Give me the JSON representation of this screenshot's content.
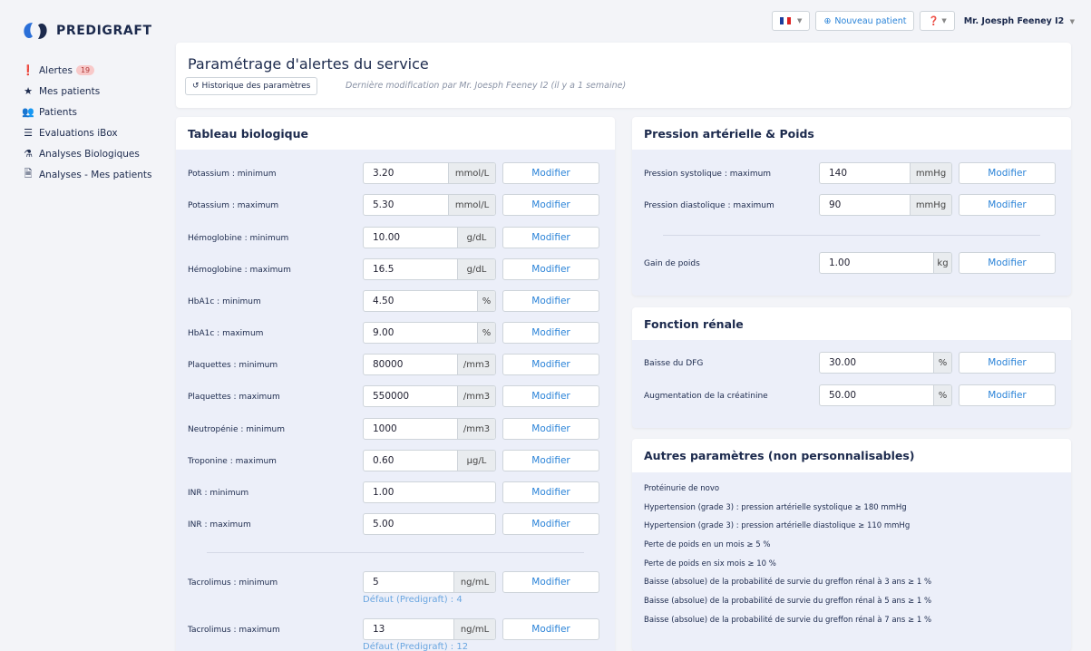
{
  "brand": {
    "name": "PREDIGRAFT"
  },
  "sidebar": {
    "items": [
      {
        "icon": "alert-icon",
        "label": "Alertes",
        "badge": "19"
      },
      {
        "icon": "star-icon",
        "label": "Mes patients"
      },
      {
        "icon": "users-icon",
        "label": "Patients"
      },
      {
        "icon": "sliders-icon",
        "label": "Evaluations iBox"
      },
      {
        "icon": "test-tube-icon",
        "label": "Analyses Biologiques"
      },
      {
        "icon": "document-star-icon",
        "label": "Analyses - Mes patients"
      }
    ]
  },
  "topbar": {
    "new_patient": "Nouveau patient",
    "user": "Mr. Joesph Feeney I2"
  },
  "header": {
    "title": "Paramétrage d'alertes du service",
    "history_button": "Historique des paramètres",
    "last_modified": "Dernière modification par Mr. Joesph Feeney I2 (il y a 1 semaine)"
  },
  "modify_label": "Modifier",
  "bio": {
    "title": "Tableau biologique",
    "rows": [
      {
        "label": "Potassium : minimum",
        "value": "3.20",
        "unit": "mmol/L"
      },
      {
        "label": "Potassium : maximum",
        "value": "5.30",
        "unit": "mmol/L"
      },
      {
        "label": "Hémoglobine : minimum",
        "value": "10.00",
        "unit": "g/dL"
      },
      {
        "label": "Hémoglobine : maximum",
        "value": "16.5",
        "unit": "g/dL"
      },
      {
        "label": "HbA1c : minimum",
        "value": "4.50",
        "unit": "%"
      },
      {
        "label": "HbA1c : maximum",
        "value": "9.00",
        "unit": "%"
      },
      {
        "label": "Plaquettes : minimum",
        "value": "80000",
        "unit": "/mm3"
      },
      {
        "label": "Plaquettes : maximum",
        "value": "550000",
        "unit": "/mm3"
      },
      {
        "label": "Neutropénie : minimum",
        "value": "1000",
        "unit": "/mm3"
      },
      {
        "label": "Troponine : maximum",
        "value": "0.60",
        "unit": "µg/L"
      },
      {
        "label": "INR : minimum",
        "value": "1.00",
        "unit": ""
      },
      {
        "label": "INR : maximum",
        "value": "5.00",
        "unit": ""
      }
    ],
    "tacro": [
      {
        "label": "Tacrolimus : minimum",
        "value": "5",
        "unit": "ng/mL",
        "hint": "Défaut (Predigraft) : 4"
      },
      {
        "label": "Tacrolimus : maximum",
        "value": "13",
        "unit": "ng/mL",
        "hint": "Défaut (Predigraft) : 12"
      }
    ]
  },
  "pression": {
    "title": "Pression artérielle & Poids",
    "rows": [
      {
        "label": "Pression systolique : maximum",
        "value": "140",
        "unit": "mmHg"
      },
      {
        "label": "Pression diastolique : maximum",
        "value": "90",
        "unit": "mmHg"
      }
    ],
    "poids": {
      "label": "Gain de poids",
      "value": "1.00",
      "unit": "kg"
    }
  },
  "renal": {
    "title": "Fonction rénale",
    "rows": [
      {
        "label": "Baisse du DFG",
        "value": "30.00",
        "unit": "%"
      },
      {
        "label": "Augmentation de la créatinine",
        "value": "50.00",
        "unit": "%"
      }
    ]
  },
  "autres": {
    "title": "Autres paramètres (non personnalisables)",
    "items": [
      "Protéinurie de novo",
      "Hypertension (grade 3) : pression artérielle systolique ≥ 180 mmHg",
      "Hypertension (grade 3) : pression artérielle diastolique ≥ 110 mmHg",
      "Perte de poids en un mois ≥ 5 %",
      "Perte de poids en six mois ≥ 10 %",
      "Baisse (absolue) de la probabilité de survie du greffon rénal à 3 ans ≥ 1 %",
      "Baisse (absolue) de la probabilité de survie du greffon rénal à 5 ans ≥ 1 %",
      "Baisse (absolue) de la probabilité de survie du greffon rénal à 7 ans ≥ 1 %"
    ]
  }
}
